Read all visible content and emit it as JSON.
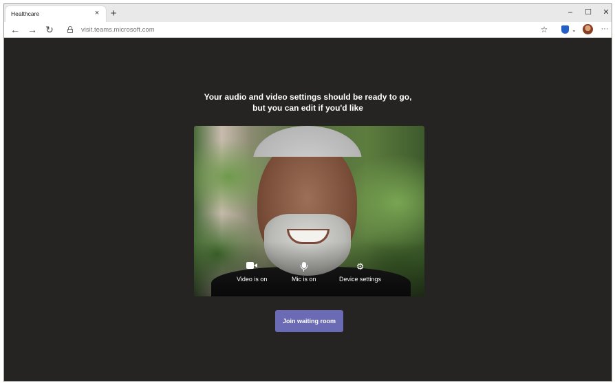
{
  "browser": {
    "tab": {
      "title": "Healthcare",
      "close_icon": "×"
    },
    "new_tab_icon": "+",
    "window_controls": {
      "minimize": "–",
      "maximize": "☐",
      "close": "✕"
    },
    "nav": {
      "back": "←",
      "forward": "→",
      "refresh": "↻"
    },
    "address": {
      "url": "visit.teams.microsoft.com"
    },
    "favorite_icon": "☆",
    "extension_chevron": "⌄",
    "more_icon": "···"
  },
  "prejoin": {
    "headline_line1": "Your audio and video settings should be ready to go,",
    "headline_line2": "but you can edit if you'd like",
    "controls": {
      "video_label": "Video is on",
      "mic_label": "Mic is on",
      "settings_label": "Device settings",
      "settings_icon": "⚙"
    },
    "join_button": "Join waiting room"
  },
  "colors": {
    "stage_background": "#252423",
    "join_button": "#6b6ab5"
  }
}
